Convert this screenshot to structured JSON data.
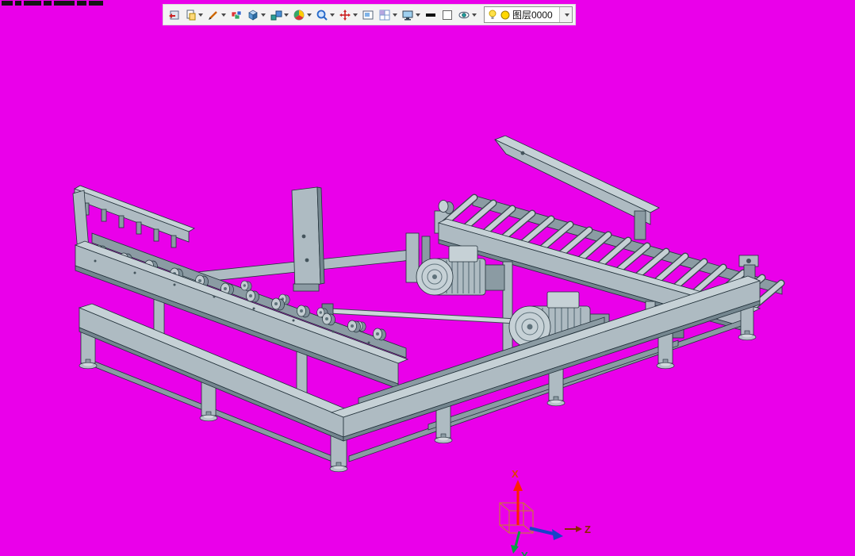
{
  "window": {
    "background_color": "#ea00ea"
  },
  "toolbar": {
    "buttons": [
      {
        "id": "open",
        "icon": "open-panel-icon",
        "dropdown": false
      },
      {
        "id": "paste",
        "icon": "paste-icon",
        "dropdown": true
      },
      {
        "id": "sketch",
        "icon": "pen-icon",
        "dropdown": true
      },
      {
        "id": "palette",
        "icon": "palette-icon",
        "dropdown": false
      },
      {
        "id": "solid",
        "icon": "cube-icon",
        "dropdown": true
      },
      {
        "id": "assembly",
        "icon": "blocks-icon",
        "dropdown": true
      },
      {
        "id": "render",
        "icon": "color-wheel-icon",
        "dropdown": true
      },
      {
        "id": "zoom",
        "icon": "magnifier-icon",
        "dropdown": true
      },
      {
        "id": "move",
        "icon": "move-cross-icon",
        "dropdown": true
      },
      {
        "id": "viewport",
        "icon": "viewport-icon",
        "dropdown": false
      },
      {
        "id": "grid",
        "icon": "grid-icon",
        "dropdown": true
      },
      {
        "id": "display",
        "icon": "monitor-icon",
        "dropdown": true
      },
      {
        "id": "line-width",
        "icon": "line-width-swatch",
        "dropdown": false
      },
      {
        "id": "color",
        "icon": "white-swatch",
        "dropdown": false
      },
      {
        "id": "visibility",
        "icon": "eye-icon",
        "dropdown": true
      }
    ],
    "layer_selector": {
      "icon": "bulb-icon",
      "swatch_color": "#ffd800",
      "value": "图层0000"
    }
  },
  "viewport": {
    "model_colors": {
      "part_light": "#c6d1d6",
      "part_mid": "#aebbc2",
      "part_dark": "#74868f",
      "outline": "#22313a"
    }
  },
  "axis_triad": {
    "x": {
      "label": "X",
      "color": "#e04000"
    },
    "y": {
      "label": "Y",
      "color": "#00a040"
    },
    "z": {
      "label": "Z",
      "color": "#8b2500"
    },
    "box_color": "#c87a33",
    "x_arrow_color": "#ff2000",
    "y_arrow_color": "#00a040",
    "z_side_arrow_color": "#1843c8"
  }
}
